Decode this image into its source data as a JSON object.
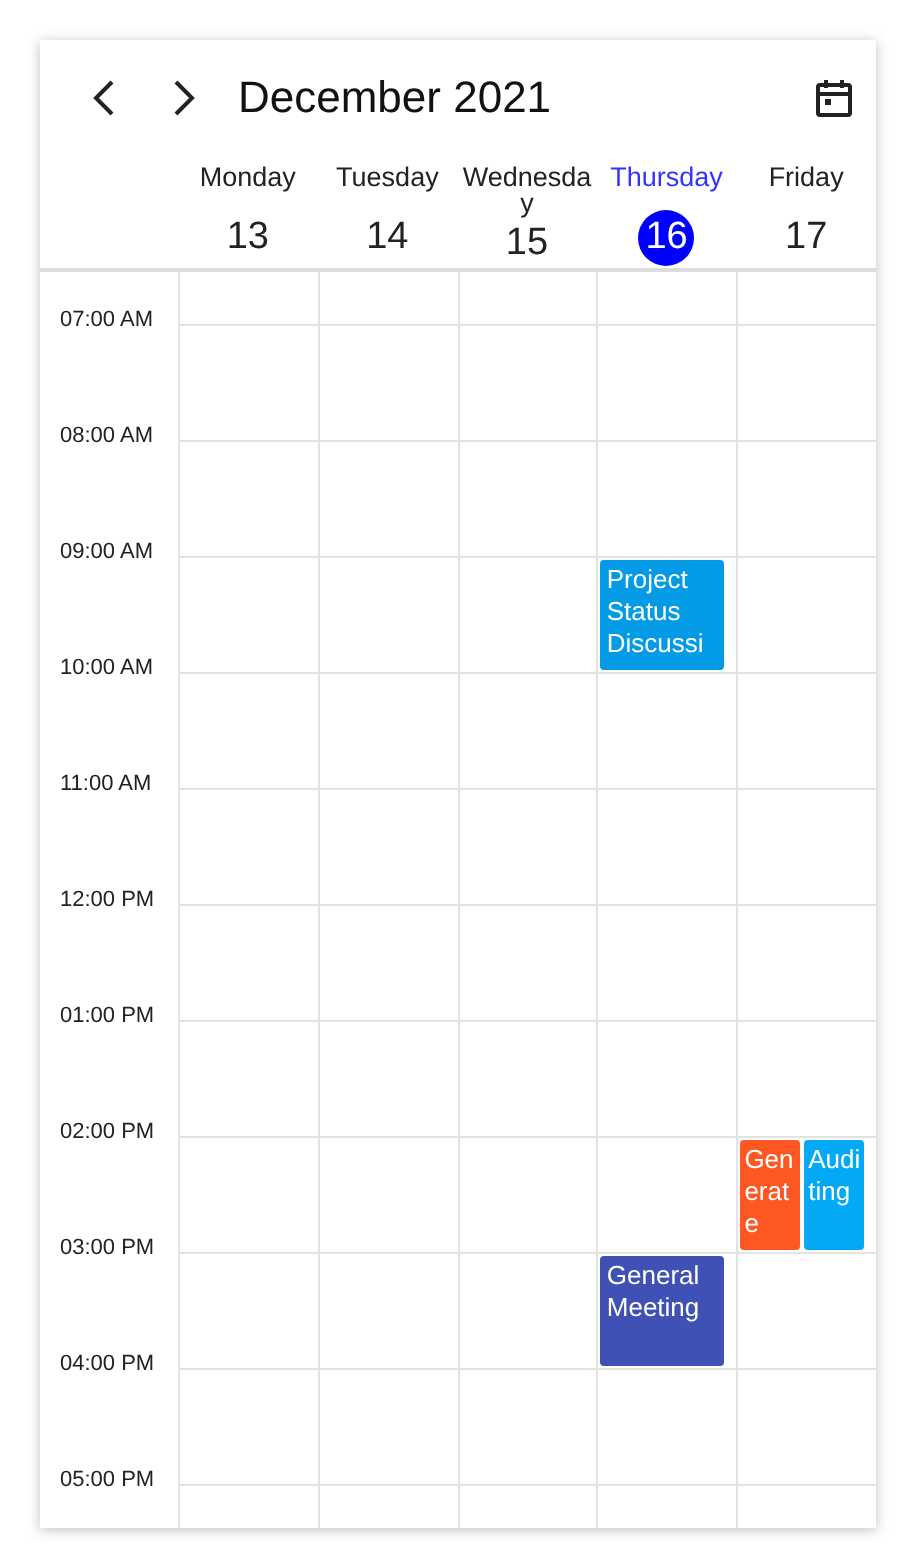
{
  "toolbar": {
    "title": "December 2021"
  },
  "days": [
    {
      "name": "Monday",
      "date": "13",
      "selected": false
    },
    {
      "name": "Tuesday",
      "date": "14",
      "selected": false
    },
    {
      "name": "Wednesday",
      "date": "15",
      "selected": false
    },
    {
      "name": "Thursday",
      "date": "16",
      "selected": true
    },
    {
      "name": "Friday",
      "date": "17",
      "selected": false
    }
  ],
  "rows": [
    {
      "time": "07:00 AM",
      "cells": [
        {},
        {},
        {},
        {},
        {}
      ]
    },
    {
      "time": "08:00 AM",
      "cells": [
        {},
        {},
        {},
        {},
        {}
      ]
    },
    {
      "time": "09:00 AM",
      "cells": [
        {},
        {},
        {},
        {
          "events": [
            {
              "title": "Project Status Discussi",
              "color": "#039be5"
            }
          ]
        },
        {}
      ]
    },
    {
      "time": "10:00 AM",
      "cells": [
        {},
        {},
        {},
        {},
        {}
      ]
    },
    {
      "time": "11:00 AM",
      "cells": [
        {},
        {},
        {},
        {},
        {}
      ]
    },
    {
      "time": "12:00 PM",
      "cells": [
        {},
        {},
        {},
        {},
        {}
      ]
    },
    {
      "time": "01:00 PM",
      "cells": [
        {},
        {},
        {},
        {},
        {}
      ]
    },
    {
      "time": "02:00 PM",
      "cells": [
        {},
        {},
        {},
        {},
        {
          "events": [
            {
              "title": "Generate",
              "color": "#ff5722"
            },
            {
              "title": "Auditing",
              "color": "#03a9f4"
            }
          ]
        }
      ]
    },
    {
      "time": "03:00 PM",
      "cells": [
        {},
        {},
        {},
        {
          "events": [
            {
              "title": "General Meeting",
              "color": "#3f51b5"
            }
          ]
        },
        {}
      ]
    },
    {
      "time": "04:00 PM",
      "cells": [
        {},
        {},
        {},
        {},
        {}
      ]
    },
    {
      "time": "05:00 PM",
      "cells": [
        {},
        {},
        {},
        {},
        {}
      ]
    }
  ]
}
